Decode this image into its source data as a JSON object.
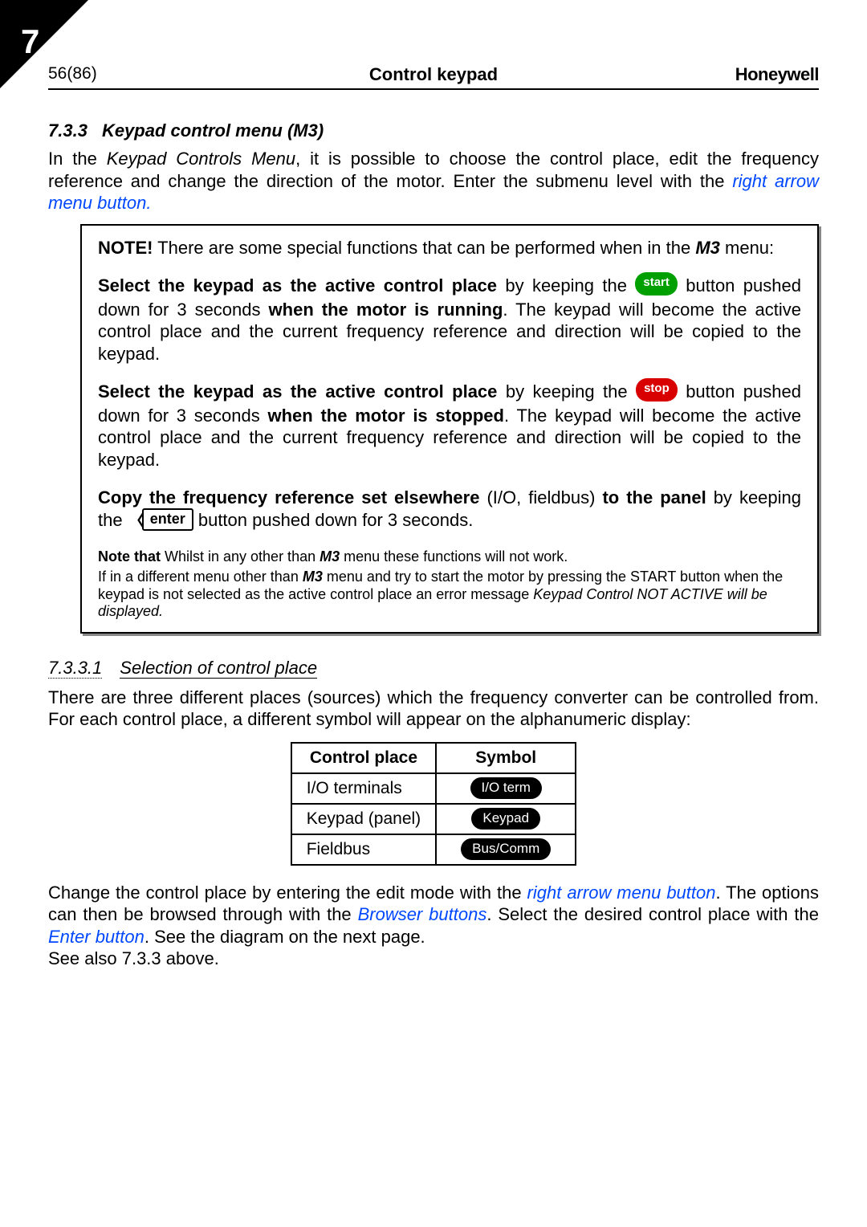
{
  "corner_number": "7",
  "header": {
    "page_ref": "56(86)",
    "title": "Control keypad",
    "brand": "Honeywell"
  },
  "section": {
    "number": "7.3.3",
    "title": "Keypad control menu (M3)"
  },
  "intro": {
    "t1": "In the ",
    "t2": "Keypad Controls Menu",
    "t3": ",  it is possible to choose the control place, edit the frequency reference and change the direction of the motor. Enter the submenu level with the ",
    "link": "right arrow menu button",
    "t4": "."
  },
  "note_box": {
    "p1a": "NOTE!",
    "p1b": " There are some special functions that can be performed when in the ",
    "p1c": "M3",
    "p1d": " menu:",
    "p2a": "Select the keypad as the active control place",
    "p2b": " by keeping the ",
    "start_label": "start",
    "p2c": " button pushed down for 3 seconds ",
    "p2d": "when the motor is running",
    "p2e": ". The keypad will become the active control place and the current frequency reference and direction will be copied to the keypad.",
    "p3a": "Select the keypad as the active control place",
    "p3b": " by keeping the ",
    "stop_label": "stop",
    "p3c": " button pushed down for 3 seconds ",
    "p3d": "when the motor is stopped",
    "p3e": ". The keypad will become the active control place and the current frequency reference and direction will be copied to the keypad.",
    "p4a": "Copy the frequency reference set elsewhere",
    "p4b": " (I/O, fieldbus) ",
    "p4c": "to the panel",
    "p4d": " by keeping the ",
    "enter_label": "enter",
    "p4e": " button pushed down for 3 seconds.",
    "p5a": "Note that ",
    "p5b": "Whilst in any other than ",
    "p5c": "M3",
    "p5d": " menu these functions will not work.",
    "p6a": "If in a different menu other than ",
    "p6b": "M3",
    "p6c": " menu and try to start the motor by pressing the START button when the keypad is not selected as the active control place an error message ",
    "p6d": "Keypad Control NOT ACTIVE will be displayed."
  },
  "subsection": {
    "number": "7.3.3.1",
    "title": "Selection of control place"
  },
  "sub_intro": "There are three different places (sources) which the frequency converter can be controlled from. For each control place, a different symbol will appear on the alphanumeric display:",
  "table": {
    "h1": "Control place",
    "h2": "Symbol",
    "r1c1": "I/O terminals",
    "r1c2": "I/O term",
    "r2c1": "Keypad (panel)",
    "r2c2": "Keypad",
    "r3c1": "Fieldbus",
    "r3c2": "Bus/Comm"
  },
  "outro": {
    "t1": "Change the control place by entering the edit mode with the ",
    "l1": "right arrow menu button",
    "t2": ". The options can then be browsed through with the ",
    "l2": "Browser buttons",
    "t3": ". Select the desired control place with the ",
    "l3": "Enter button",
    "t4": ". See the diagram on the next page.",
    "t5": "See also 7.3.3 above."
  }
}
